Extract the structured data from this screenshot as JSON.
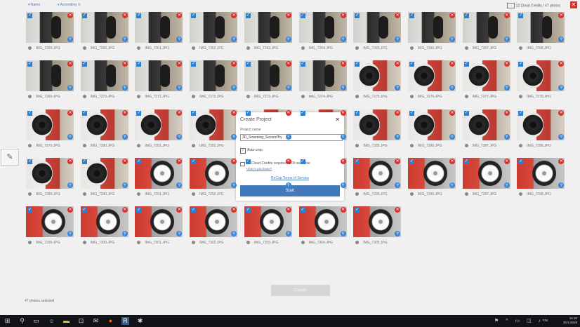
{
  "toolbar": {
    "sort_name": "Name",
    "sort_order": "Ascending",
    "credits": "12 Cloud Credits / 47 photos",
    "close": "✕"
  },
  "photos": [
    {
      "label": "IMG_7259.JPG",
      "kind": "car"
    },
    {
      "label": "IMG_7260.JPG",
      "kind": "car"
    },
    {
      "label": "IMG_7261.JPG",
      "kind": "car"
    },
    {
      "label": "IMG_7262.JPG",
      "kind": "car"
    },
    {
      "label": "IMG_7263.JPG",
      "kind": "car"
    },
    {
      "label": "IMG_7264.JPG",
      "kind": "car"
    },
    {
      "label": "IMG_7265.JPG",
      "kind": "car"
    },
    {
      "label": "IMG_7266.JPG",
      "kind": "car"
    },
    {
      "label": "IMG_7267.JPG",
      "kind": "car"
    },
    {
      "label": "IMG_7268.JPG",
      "kind": "car"
    },
    {
      "label": "IMG_7269.JPG",
      "kind": "car"
    },
    {
      "label": "IMG_7270.JPG",
      "kind": "car"
    },
    {
      "label": "IMG_7271.JPG",
      "kind": "car"
    },
    {
      "label": "IMG_7272.JPG",
      "kind": "car"
    },
    {
      "label": "IMG_7273.JPG",
      "kind": "car"
    },
    {
      "label": "IMG_7274.JPG",
      "kind": "car"
    },
    {
      "label": "IMG_7275.JPG",
      "kind": "tire"
    },
    {
      "label": "IMG_7276.JPG",
      "kind": "tire"
    },
    {
      "label": "IMG_7277.JPG",
      "kind": "tire"
    },
    {
      "label": "IMG_7278.JPG",
      "kind": "tire"
    },
    {
      "label": "IMG_7279.JPG",
      "kind": "tire"
    },
    {
      "label": "IMG_7280.JPG",
      "kind": "tire"
    },
    {
      "label": "IMG_7281.JPG",
      "kind": "tire"
    },
    {
      "label": "IMG_7282.JPG",
      "kind": "tire"
    },
    {
      "label": "IMG_7283.JPG",
      "kind": "tire"
    },
    {
      "label": "IMG_7284.JPG",
      "kind": "tire"
    },
    {
      "label": "IMG_7285.JPG",
      "kind": "tire"
    },
    {
      "label": "IMG_7286.JPG",
      "kind": "tire"
    },
    {
      "label": "IMG_7287.JPG",
      "kind": "tire"
    },
    {
      "label": "IMG_7288.JPG",
      "kind": "tire"
    },
    {
      "label": "IMG_7289.JPG",
      "kind": "tire"
    },
    {
      "label": "IMG_7290.JPG",
      "kind": "tire"
    },
    {
      "label": "IMG_7291.JPG",
      "kind": "wheel"
    },
    {
      "label": "IMG_7292.JPG",
      "kind": "wheel"
    },
    {
      "label": "IMG_7293.JPG",
      "kind": "wheel"
    },
    {
      "label": "IMG_7294.JPG",
      "kind": "wheel"
    },
    {
      "label": "IMG_7295.JPG",
      "kind": "wheel"
    },
    {
      "label": "IMG_7296.JPG",
      "kind": "wheel"
    },
    {
      "label": "IMG_7297.JPG",
      "kind": "wheel"
    },
    {
      "label": "IMG_7298.JPG",
      "kind": "wheel"
    },
    {
      "label": "IMG_7299.JPG",
      "kind": "wheel"
    },
    {
      "label": "IMG_7300.JPG",
      "kind": "wheel"
    },
    {
      "label": "IMG_7301.JPG",
      "kind": "wheel"
    },
    {
      "label": "IMG_7302.JPG",
      "kind": "wheel"
    },
    {
      "label": "IMG_7303.JPG",
      "kind": "wheel"
    },
    {
      "label": "IMG_7304.JPG",
      "kind": "wheel"
    },
    {
      "label": "IMG_7305.JPG",
      "kind": "wheel"
    }
  ],
  "modal": {
    "title": "Create Project",
    "close": "✕",
    "name_label": "Project name",
    "name_value": "3D_Scanning_SecondTry",
    "autocrop_label": "Auto-crop",
    "autocrop_checked": true,
    "credits_text": "12 Cloud Credits required / 100 available",
    "how_to_purchase": "How to purchase?",
    "terms": "ReCap Terms of Service",
    "start": "Start"
  },
  "footer": {
    "create": "Create",
    "selected": "47 photos selected"
  },
  "taskbar": {
    "time": "15.10",
    "date": "30.5.2018",
    "lang": "FIN"
  }
}
